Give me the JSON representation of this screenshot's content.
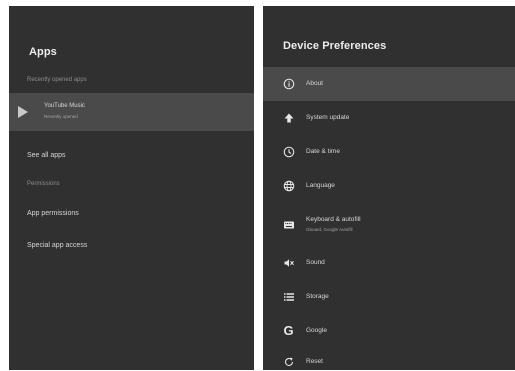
{
  "apps_panel": {
    "title": "Apps",
    "recently_opened_label": "Recently opened apps",
    "recent_app": {
      "name": "YouTube Music",
      "subtitle": "Recently opened"
    },
    "see_all_label": "See all apps",
    "permissions_label": "Permissions",
    "menu_items": [
      "App permissions",
      "Special app access"
    ]
  },
  "prefs_panel": {
    "title": "Device Preferences",
    "items": [
      {
        "icon": "info-icon",
        "label": "About",
        "sub": ""
      },
      {
        "icon": "system-update-icon",
        "label": "System update",
        "sub": ""
      },
      {
        "icon": "clock-icon",
        "label": "Date & time",
        "sub": ""
      },
      {
        "icon": "language-icon",
        "label": "Language",
        "sub": ""
      },
      {
        "icon": "keyboard-icon",
        "label": "Keyboard & autofill",
        "sub": "Gboard, Google Autofill"
      },
      {
        "icon": "sound-icon",
        "label": "Sound",
        "sub": ""
      },
      {
        "icon": "storage-icon",
        "label": "Storage",
        "sub": ""
      },
      {
        "icon": "google-icon",
        "label": "Google",
        "sub": ""
      },
      {
        "icon": "reset-icon",
        "label": "Reset",
        "sub": ""
      }
    ]
  }
}
